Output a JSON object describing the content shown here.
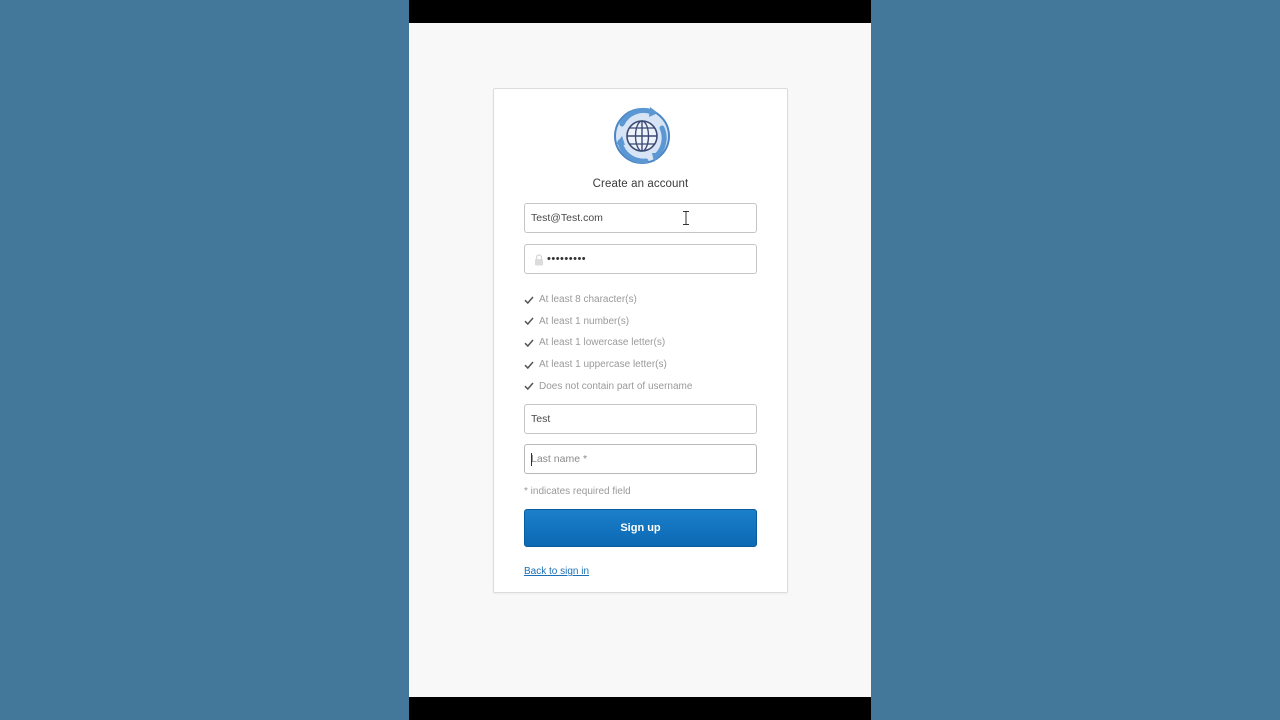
{
  "form": {
    "title": "Create an account",
    "email": {
      "value": "Test@Test.com",
      "placeholder": ""
    },
    "password": {
      "value": "•••••••••"
    },
    "password_rules": [
      {
        "label": "At least 8 character(s)",
        "met": true
      },
      {
        "label": "At least 1 number(s)",
        "met": true
      },
      {
        "label": "At least 1 lowercase letter(s)",
        "met": true
      },
      {
        "label": "At least 1 uppercase letter(s)",
        "met": true
      },
      {
        "label": "Does not contain part of username",
        "met": true
      }
    ],
    "first_name": {
      "value": "Test"
    },
    "last_name": {
      "value": "",
      "placeholder": "Last name *"
    },
    "required_note": "* indicates required field",
    "submit_label": "Sign up",
    "back_link": "Back to sign in"
  },
  "icons": {
    "logo": "globe-with-arrows-icon",
    "lock": "lock-icon",
    "check": "checkmark-icon",
    "cursor": "text-cursor-icon"
  },
  "colors": {
    "background": "#43789a",
    "page": "#f8f8f8",
    "primary": "#0c69b4",
    "link": "#1a6fb5",
    "muted_text": "#9a9a9a"
  }
}
